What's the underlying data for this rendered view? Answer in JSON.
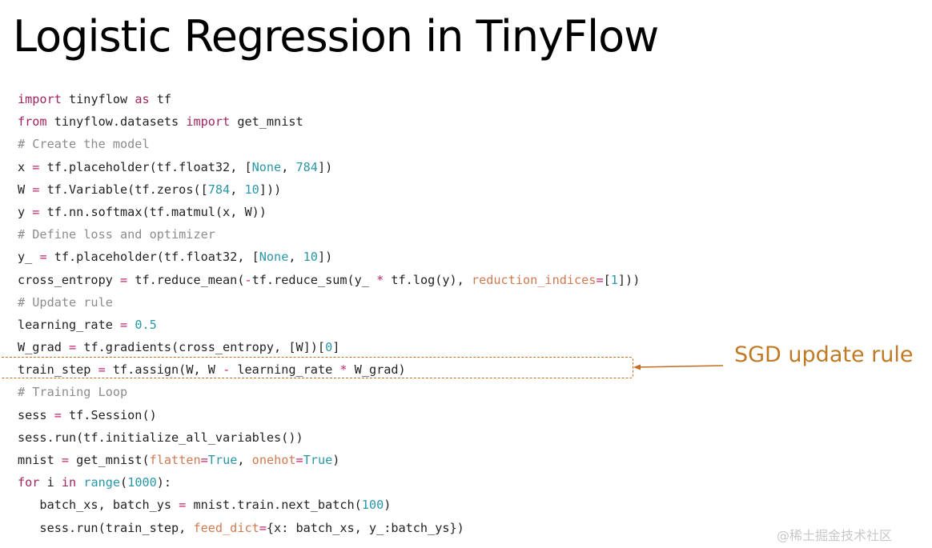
{
  "slide": {
    "title": "Logistic Regression in TinyFlow",
    "annotation": "SGD update rule",
    "highlighted_line_index": 13,
    "watermark": "@稀土掘金技术社区",
    "colors": {
      "keyword": "#a0255f",
      "number": "#2a97a8",
      "comment": "#8c8c8c",
      "keyword_arg": "#d07a52",
      "annotation": "#c07a25"
    }
  },
  "code": {
    "lines": [
      [
        [
          "import",
          "kw"
        ],
        [
          " tinyflow ",
          "pl"
        ],
        [
          "as",
          "kw"
        ],
        [
          " tf",
          "pl"
        ]
      ],
      [
        [
          "from",
          "kw"
        ],
        [
          " tinyflow.datasets ",
          "pl"
        ],
        [
          "import",
          "kw"
        ],
        [
          " get_mnist",
          "pl"
        ]
      ],
      [
        [
          "# Create the model",
          "com"
        ]
      ],
      [
        [
          "x ",
          "pl"
        ],
        [
          "=",
          "op"
        ],
        [
          " tf.placeholder(tf.float32, [",
          "pl"
        ],
        [
          "None",
          "num"
        ],
        [
          ", ",
          "pl"
        ],
        [
          "784",
          "num"
        ],
        [
          "])",
          "pl"
        ]
      ],
      [
        [
          "W ",
          "pl"
        ],
        [
          "=",
          "op"
        ],
        [
          " tf.Variable(tf.zeros([",
          "pl"
        ],
        [
          "784",
          "num"
        ],
        [
          ", ",
          "pl"
        ],
        [
          "10",
          "num"
        ],
        [
          "]))",
          "pl"
        ]
      ],
      [
        [
          "y ",
          "pl"
        ],
        [
          "=",
          "op"
        ],
        [
          " tf.nn.softmax(tf.matmul(x, W))",
          "pl"
        ]
      ],
      [
        [
          "# Define loss and optimizer",
          "com"
        ]
      ],
      [
        [
          "y_ ",
          "pl"
        ],
        [
          "=",
          "op"
        ],
        [
          " tf.placeholder(tf.float32, [",
          "pl"
        ],
        [
          "None",
          "num"
        ],
        [
          ", ",
          "pl"
        ],
        [
          "10",
          "num"
        ],
        [
          "])",
          "pl"
        ]
      ],
      [
        [
          "cross_entropy ",
          "pl"
        ],
        [
          "=",
          "op"
        ],
        [
          " tf.reduce_mean(",
          "pl"
        ],
        [
          "-",
          "op"
        ],
        [
          "tf.reduce_sum(y_ ",
          "pl"
        ],
        [
          "*",
          "op"
        ],
        [
          " tf.log(y), ",
          "pl"
        ],
        [
          "reduction_indices",
          "arg"
        ],
        [
          "=",
          "op"
        ],
        [
          "[",
          "pl"
        ],
        [
          "1",
          "num"
        ],
        [
          "]))",
          "pl"
        ]
      ],
      [
        [
          "# Update rule",
          "com"
        ]
      ],
      [
        [
          "learning_rate ",
          "pl"
        ],
        [
          "=",
          "op"
        ],
        [
          " ",
          "pl"
        ],
        [
          "0.5",
          "num"
        ]
      ],
      [
        [
          "W_grad ",
          "pl"
        ],
        [
          "=",
          "op"
        ],
        [
          " tf.gradients(cross_entropy, [W])[",
          "pl"
        ],
        [
          "0",
          "num"
        ],
        [
          "]",
          "pl"
        ]
      ],
      [
        [
          "train_step ",
          "pl"
        ],
        [
          "=",
          "op"
        ],
        [
          " tf.assign(W, W ",
          "pl"
        ],
        [
          "-",
          "op"
        ],
        [
          " learning_rate ",
          "pl"
        ],
        [
          "*",
          "op"
        ],
        [
          " W_grad)",
          "pl"
        ]
      ],
      [
        [
          "# Training Loop",
          "com"
        ]
      ],
      [
        [
          "sess ",
          "pl"
        ],
        [
          "=",
          "op"
        ],
        [
          " tf.Session()",
          "pl"
        ]
      ],
      [
        [
          "sess.run(tf.initialize_all_variables())",
          "pl"
        ]
      ],
      [
        [
          "mnist ",
          "pl"
        ],
        [
          "=",
          "op"
        ],
        [
          " get_mnist(",
          "pl"
        ],
        [
          "flatten",
          "arg"
        ],
        [
          "=",
          "op"
        ],
        [
          "True",
          "num"
        ],
        [
          ", ",
          "pl"
        ],
        [
          "onehot",
          "arg"
        ],
        [
          "=",
          "op"
        ],
        [
          "True",
          "num"
        ],
        [
          ")",
          "pl"
        ]
      ],
      [
        [
          "for",
          "kw"
        ],
        [
          " i ",
          "pl"
        ],
        [
          "in",
          "kw"
        ],
        [
          " ",
          "pl"
        ],
        [
          "range",
          "fn"
        ],
        [
          "(",
          "pl"
        ],
        [
          "1000",
          "num"
        ],
        [
          "):",
          "pl"
        ]
      ],
      [
        [
          "   batch_xs, batch_ys ",
          "pl"
        ],
        [
          "=",
          "op"
        ],
        [
          " mnist.train.next_batch(",
          "pl"
        ],
        [
          "100",
          "num"
        ],
        [
          ")",
          "pl"
        ]
      ],
      [
        [
          "   sess.run(train_step, ",
          "pl"
        ],
        [
          "feed_dict",
          "arg"
        ],
        [
          "=",
          "op"
        ],
        [
          "{x: batch_xs, y_:batch_ys})",
          "pl"
        ]
      ]
    ]
  }
}
